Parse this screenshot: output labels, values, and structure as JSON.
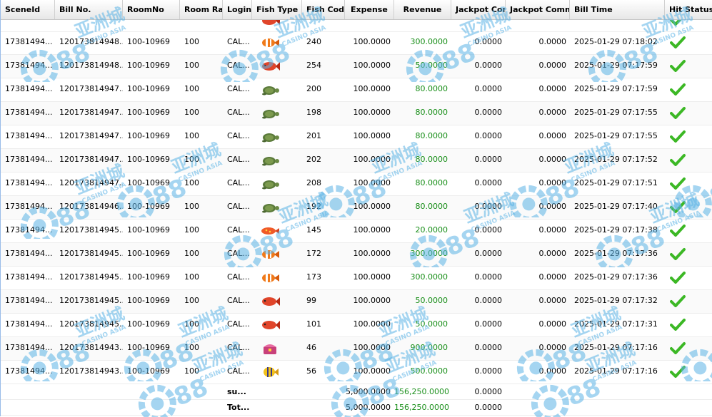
{
  "columns": [
    {
      "key": "scene_id",
      "label": "SceneId"
    },
    {
      "key": "bill_no",
      "label": "Bill No."
    },
    {
      "key": "room_no",
      "label": "RoomNo"
    },
    {
      "key": "room_rate",
      "label": "Room Rat"
    },
    {
      "key": "login",
      "label": "Login"
    },
    {
      "key": "fish_type",
      "label": "Fish Type"
    },
    {
      "key": "fish_code",
      "label": "Fish Code"
    },
    {
      "key": "expense",
      "label": "Expense"
    },
    {
      "key": "revenue",
      "label": "Revenue"
    },
    {
      "key": "jackpot_con",
      "label": "Jackpot Con"
    },
    {
      "key": "jackpot_comm",
      "label": "Jackpot Comm"
    },
    {
      "key": "bill_time",
      "label": "Bill Time"
    },
    {
      "key": "hit_status",
      "label": "Hit Status"
    }
  ],
  "rows": [
    {
      "scene_id": "17381494...",
      "bill_no": "120173814948...",
      "room_no": "100-10969",
      "room_rate": "100",
      "login": "CAL...",
      "fish_icon": "clownfish-icon",
      "fish_code": "240",
      "expense": "100.0000",
      "revenue": "300.0000",
      "jackpot_con": "0.0000",
      "jackpot_comm": "0.0000",
      "bill_time": "2025-01-29 07:18:02",
      "hit_icon": "checkmark-icon"
    },
    {
      "scene_id": "17381494...",
      "bill_no": "120173814948...",
      "room_no": "100-10969",
      "room_rate": "100",
      "login": "CAL...",
      "fish_icon": "red-fish-icon",
      "fish_code": "254",
      "expense": "100.0000",
      "revenue": "50.0000",
      "jackpot_con": "0.0000",
      "jackpot_comm": "0.0000",
      "bill_time": "2025-01-29 07:17:59",
      "hit_icon": "checkmark-icon"
    },
    {
      "scene_id": "17381494...",
      "bill_no": "120173814947...",
      "room_no": "100-10969",
      "room_rate": "100",
      "login": "CAL...",
      "fish_icon": "turtle-icon",
      "fish_code": "200",
      "expense": "100.0000",
      "revenue": "80.0000",
      "jackpot_con": "0.0000",
      "jackpot_comm": "0.0000",
      "bill_time": "2025-01-29 07:17:59",
      "hit_icon": "checkmark-icon"
    },
    {
      "scene_id": "17381494...",
      "bill_no": "120173814947...",
      "room_no": "100-10969",
      "room_rate": "100",
      "login": "CAL...",
      "fish_icon": "turtle-icon",
      "fish_code": "198",
      "expense": "100.0000",
      "revenue": "80.0000",
      "jackpot_con": "0.0000",
      "jackpot_comm": "0.0000",
      "bill_time": "2025-01-29 07:17:55",
      "hit_icon": "checkmark-icon"
    },
    {
      "scene_id": "17381494...",
      "bill_no": "120173814947...",
      "room_no": "100-10969",
      "room_rate": "100",
      "login": "CAL...",
      "fish_icon": "turtle-icon",
      "fish_code": "201",
      "expense": "100.0000",
      "revenue": "80.0000",
      "jackpot_con": "0.0000",
      "jackpot_comm": "0.0000",
      "bill_time": "2025-01-29 07:17:55",
      "hit_icon": "checkmark-icon"
    },
    {
      "scene_id": "17381494...",
      "bill_no": "120173814947...",
      "room_no": "100-10969",
      "room_rate": "100",
      "login": "CAL...",
      "fish_icon": "turtle-icon",
      "fish_code": "202",
      "expense": "100.0000",
      "revenue": "80.0000",
      "jackpot_con": "0.0000",
      "jackpot_comm": "0.0000",
      "bill_time": "2025-01-29 07:17:52",
      "hit_icon": "checkmark-icon"
    },
    {
      "scene_id": "17381494...",
      "bill_no": "120173814947...",
      "room_no": "100-10969",
      "room_rate": "100",
      "login": "CAL...",
      "fish_icon": "turtle-icon",
      "fish_code": "208",
      "expense": "100.0000",
      "revenue": "80.0000",
      "jackpot_con": "0.0000",
      "jackpot_comm": "0.0000",
      "bill_time": "2025-01-29 07:17:51",
      "hit_icon": "checkmark-icon"
    },
    {
      "scene_id": "17381494...",
      "bill_no": "120173814946...",
      "room_no": "100-10969",
      "room_rate": "100",
      "login": "CAL...",
      "fish_icon": "turtle-icon",
      "fish_code": "192",
      "expense": "100.0000",
      "revenue": "80.0000",
      "jackpot_con": "0.0000",
      "jackpot_comm": "0.0000",
      "bill_time": "2025-01-29 07:17:40",
      "hit_icon": "checkmark-icon"
    },
    {
      "scene_id": "17381494...",
      "bill_no": "120173814945...",
      "room_no": "100-10969",
      "room_rate": "100",
      "login": "CAL...",
      "fish_icon": "spotted-fish-icon",
      "fish_code": "145",
      "expense": "100.0000",
      "revenue": "20.0000",
      "jackpot_con": "0.0000",
      "jackpot_comm": "0.0000",
      "bill_time": "2025-01-29 07:17:38",
      "hit_icon": "checkmark-icon"
    },
    {
      "scene_id": "17381494...",
      "bill_no": "120173814945...",
      "room_no": "100-10969",
      "room_rate": "100",
      "login": "CAL...",
      "fish_icon": "clownfish-icon",
      "fish_code": "172",
      "expense": "100.0000",
      "revenue": "300.0000",
      "jackpot_con": "0.0000",
      "jackpot_comm": "0.0000",
      "bill_time": "2025-01-29 07:17:36",
      "hit_icon": "checkmark-icon"
    },
    {
      "scene_id": "17381494...",
      "bill_no": "120173814945...",
      "room_no": "100-10969",
      "room_rate": "100",
      "login": "CAL...",
      "fish_icon": "clownfish-icon",
      "fish_code": "173",
      "expense": "100.0000",
      "revenue": "300.0000",
      "jackpot_con": "0.0000",
      "jackpot_comm": "0.0000",
      "bill_time": "2025-01-29 07:17:36",
      "hit_icon": "checkmark-icon"
    },
    {
      "scene_id": "17381494...",
      "bill_no": "120173814945...",
      "room_no": "100-10969",
      "room_rate": "100",
      "login": "CAL...",
      "fish_icon": "red-fish-icon",
      "fish_code": "99",
      "expense": "100.0000",
      "revenue": "50.0000",
      "jackpot_con": "0.0000",
      "jackpot_comm": "0.0000",
      "bill_time": "2025-01-29 07:17:32",
      "hit_icon": "checkmark-icon"
    },
    {
      "scene_id": "17381494...",
      "bill_no": "120173814945...",
      "room_no": "100-10969",
      "room_rate": "100",
      "login": "CAL...",
      "fish_icon": "red-fish-icon",
      "fish_code": "101",
      "expense": "100.0000",
      "revenue": "50.0000",
      "jackpot_con": "0.0000",
      "jackpot_comm": "0.0000",
      "bill_time": "2025-01-29 07:17:31",
      "hit_icon": "checkmark-icon"
    },
    {
      "scene_id": "17381494...",
      "bill_no": "120173814943...",
      "room_no": "100-10969",
      "room_rate": "100",
      "login": "CAL...",
      "fish_icon": "treasure-chest-icon",
      "fish_code": "46",
      "expense": "100.0000",
      "revenue": "900.0000",
      "jackpot_con": "0.0000",
      "jackpot_comm": "0.0000",
      "bill_time": "2025-01-29 07:17:16",
      "hit_icon": "checkmark-icon"
    },
    {
      "scene_id": "17381494...",
      "bill_no": "120173814943...",
      "room_no": "100-10969",
      "room_rate": "100",
      "login": "CAL...",
      "fish_icon": "butterflyfish-icon",
      "fish_code": "56",
      "expense": "100.0000",
      "revenue": "500.0000",
      "jackpot_con": "0.0000",
      "jackpot_comm": "0.0000",
      "bill_time": "2025-01-29 07:17:16",
      "hit_icon": "checkmark-icon"
    }
  ],
  "summary": {
    "label": "su...",
    "expense": "5,000.0000",
    "revenue": "156,250.0000",
    "jackpot_con": "0.0000"
  },
  "total": {
    "label": "Tot...",
    "expense": "5,000.0000",
    "revenue": "156,250.0000",
    "jackpot_con": "0.0000"
  },
  "watermark": {
    "brand": "GCI88",
    "chinese": "亚洲城",
    "sub": "CASINO ASIA"
  },
  "colors": {
    "revenue": "#1a8f1a",
    "check": "#3cb825",
    "header_border": "#c5c5c5",
    "watermark": "#5cb4e6"
  }
}
